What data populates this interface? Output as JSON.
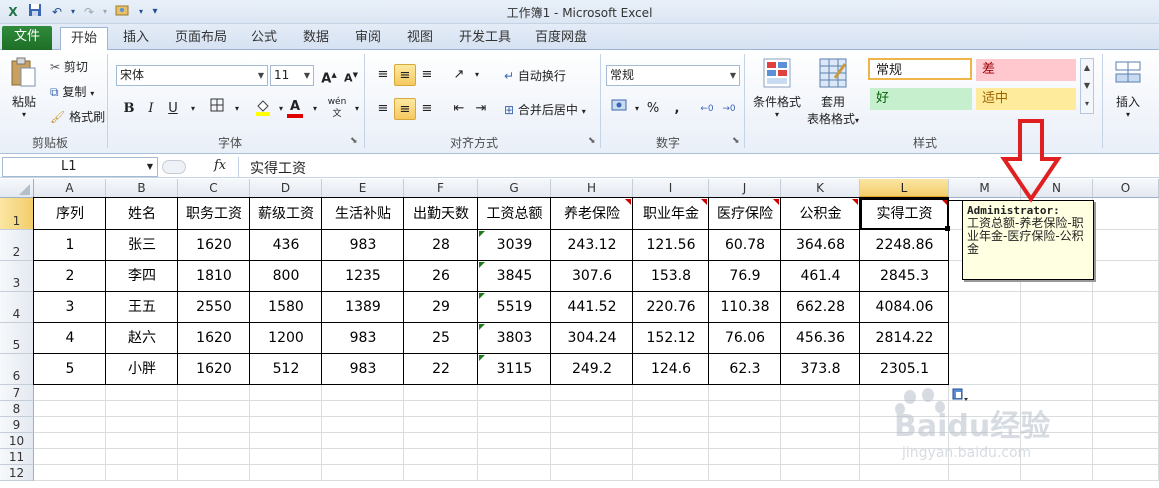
{
  "window": {
    "title": "工作簿1 - Microsoft Excel"
  },
  "tabs": [
    {
      "label": "文件"
    },
    {
      "label": "开始"
    },
    {
      "label": "插入"
    },
    {
      "label": "页面布局"
    },
    {
      "label": "公式"
    },
    {
      "label": "数据"
    },
    {
      "label": "审阅"
    },
    {
      "label": "视图"
    },
    {
      "label": "开发工具"
    },
    {
      "label": "百度网盘"
    }
  ],
  "ribbon": {
    "clipboard": {
      "paste": "粘贴",
      "cut": "剪切",
      "copy": "复制",
      "format_painter": "格式刷",
      "group": "剪贴板"
    },
    "font": {
      "name": "宋体",
      "size": "11",
      "group": "字体",
      "bold": "B",
      "italic": "I",
      "underline": "U",
      "phonetic": "wén"
    },
    "alignment": {
      "wrap": "自动换行",
      "merge": "合并后居中",
      "group": "对齐方式"
    },
    "number": {
      "format": "常规",
      "percent": "%",
      "comma": ",",
      "group": "数字"
    },
    "styles": {
      "conditional": "条件格式",
      "table1": "套用",
      "table2": "表格格式",
      "normal": "常规",
      "bad": "差",
      "good": "好",
      "neutral": "适中",
      "group": "样式"
    },
    "cells": {
      "insert": "插入"
    }
  },
  "formula_bar": {
    "name_box": "L1",
    "fx": "fx",
    "content": "实得工资"
  },
  "columns": [
    "A",
    "B",
    "C",
    "D",
    "E",
    "F",
    "G",
    "H",
    "I",
    "J",
    "K",
    "L",
    "M",
    "N",
    "O"
  ],
  "rows": [
    "1",
    "2",
    "3",
    "4",
    "5",
    "6",
    "7",
    "8",
    "9",
    "10",
    "11",
    "12"
  ],
  "table": {
    "headers": [
      "序列",
      "姓名",
      "职务工资",
      "薪级工资",
      "生活补贴",
      "出勤天数",
      "工资总额",
      "养老保险",
      "职业年金",
      "医疗保险",
      "公积金",
      "实得工资"
    ],
    "data": [
      [
        "1",
        "张三",
        "1620",
        "436",
        "983",
        "28",
        "3039",
        "243.12",
        "121.56",
        "60.78",
        "364.68",
        "2248.86"
      ],
      [
        "2",
        "李四",
        "1810",
        "800",
        "1235",
        "26",
        "3845",
        "307.6",
        "153.8",
        "76.9",
        "461.4",
        "2845.3"
      ],
      [
        "3",
        "王五",
        "2550",
        "1580",
        "1389",
        "29",
        "5519",
        "441.52",
        "220.76",
        "110.38",
        "662.28",
        "4084.06"
      ],
      [
        "4",
        "赵六",
        "1620",
        "1200",
        "983",
        "25",
        "3803",
        "304.24",
        "152.12",
        "76.06",
        "456.36",
        "2814.22"
      ],
      [
        "5",
        "小胖",
        "1620",
        "512",
        "983",
        "22",
        "3115",
        "249.2",
        "124.6",
        "62.3",
        "373.8",
        "2305.1"
      ]
    ]
  },
  "comment": {
    "author": "Administrator:",
    "text": "工资总额-养老保险-职业年金-医疗保险-公积金"
  },
  "colors": {
    "arrow": "#e02020",
    "selection": "#217346",
    "file_tab": "#2a7d33"
  },
  "watermark": {
    "brand": "Baidu经验",
    "url": "jingyan.baidu.com"
  }
}
